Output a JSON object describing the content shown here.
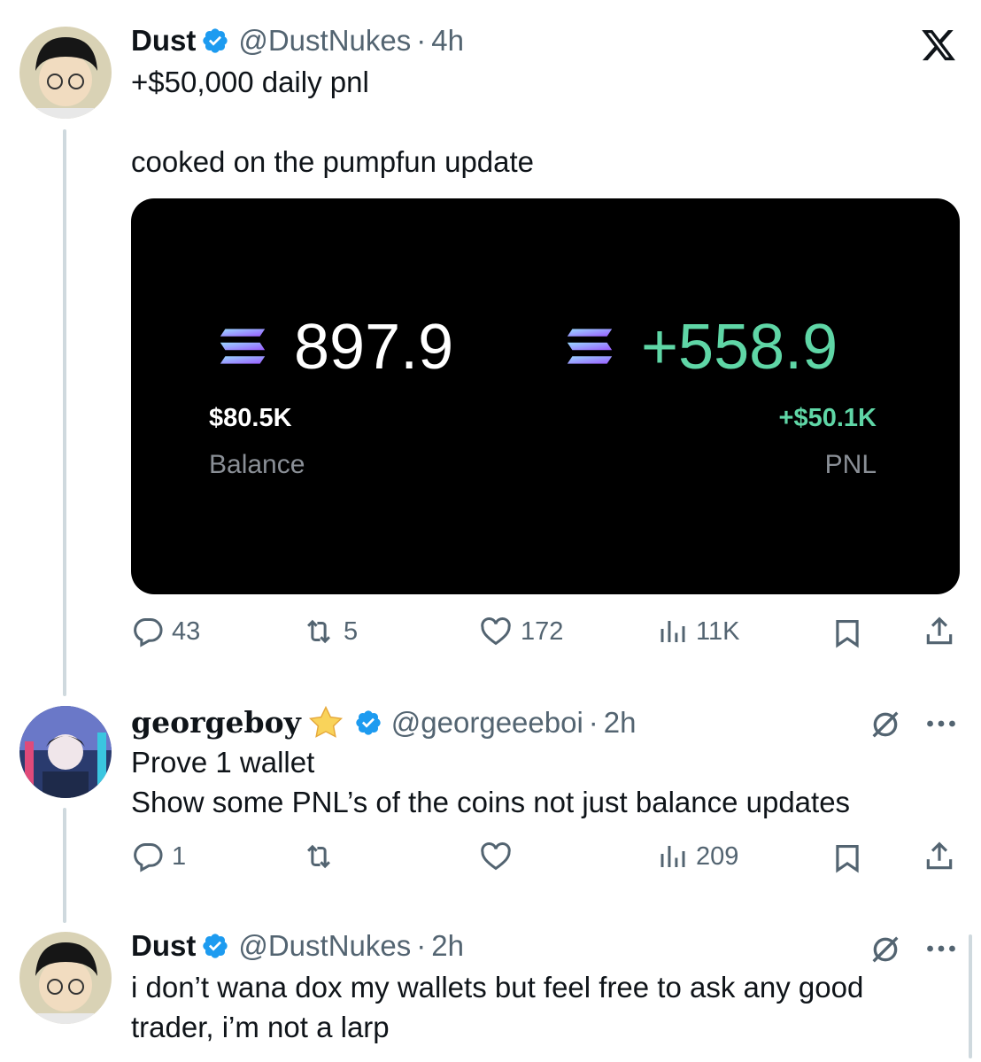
{
  "post": {
    "name": "Dust",
    "handle": "@DustNukes",
    "time": "4h",
    "text_line1": "+$50,000 daily pnl",
    "text_line2": "cooked on the pumpfun update",
    "media": {
      "balance_sol": "897.9",
      "balance_usd": "$80.5K",
      "balance_label": "Balance",
      "pnl_sol": "+558.9",
      "pnl_usd": "+$50.1K",
      "pnl_label": "PNL",
      "colors": {
        "pnl_green": "#5fd6a6",
        "gray": "#8a8f96"
      }
    },
    "stats": {
      "replies": "43",
      "reposts": "5",
      "likes": "172",
      "views": "11K"
    }
  },
  "reply1": {
    "name": "georgeboy",
    "handle": "@georgeeeboi",
    "time": "2h",
    "text_line1": "Prove 1 wallet",
    "text_line2": "Show some PNL’s of the coins not just balance updates",
    "stats": {
      "replies": "1",
      "views": "209"
    }
  },
  "reply2": {
    "name": "Dust",
    "handle": "@DustNukes",
    "time": "2h",
    "text_line1": "i don’t wana dox my wallets but feel free to ask any good",
    "text_line2": "trader, i’m not a larp"
  },
  "icons": {
    "close": "x-logo-icon",
    "verified_color": "#1d9bf0",
    "grok": "grok-icon",
    "more": "more-icon"
  },
  "separator": "·"
}
